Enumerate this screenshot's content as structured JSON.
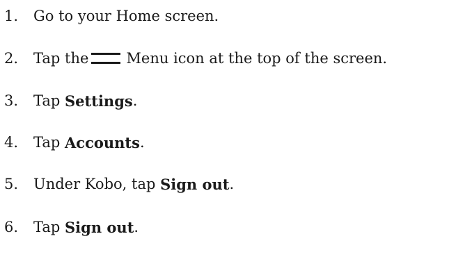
{
  "steps": [
    {
      "number": "1.",
      "pre": "Go to your Home screen.",
      "bold": "",
      "post": ""
    },
    {
      "number": "2.",
      "pre": "Tap the",
      "icon": "menu-icon",
      "post": "Menu icon at the top of the screen."
    },
    {
      "number": "3.",
      "pre": "Tap ",
      "bold": "Settings",
      "post": "."
    },
    {
      "number": "4.",
      "pre": "Tap ",
      "bold": "Accounts",
      "post": "."
    },
    {
      "number": "5.",
      "pre": "Under Kobo, tap ",
      "bold": "Sign out",
      "post": "."
    },
    {
      "number": "6.",
      "pre": "Tap ",
      "bold": "Sign out",
      "post": "."
    }
  ],
  "colors": {
    "text": "#1a1a1a",
    "icon": "#1a1a1a",
    "background": "#ffffff"
  }
}
